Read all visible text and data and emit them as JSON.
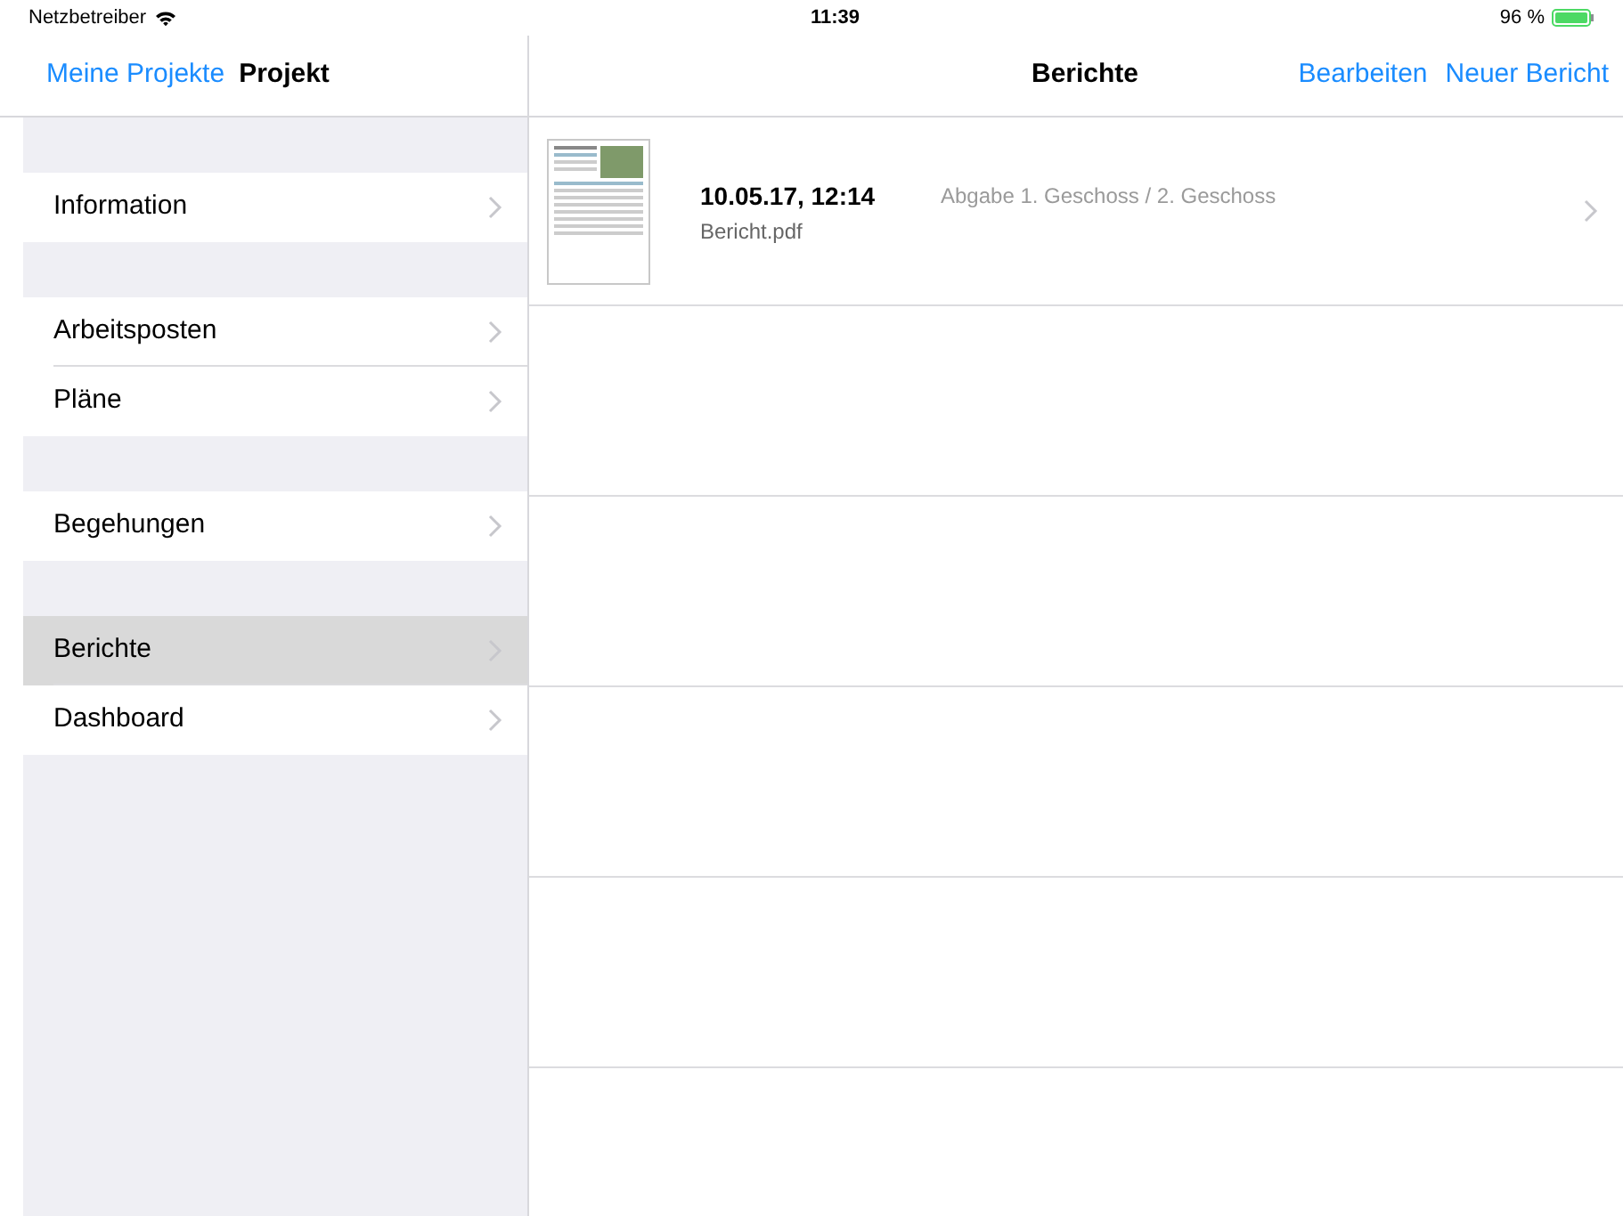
{
  "status_bar": {
    "carrier": "Netzbetreiber",
    "time": "11:39",
    "battery": "96 %"
  },
  "sidebar": {
    "back": "Meine Projekte",
    "title": "Projekt",
    "sections": [
      {
        "items": [
          {
            "label": "Information",
            "selected": false
          }
        ]
      },
      {
        "items": [
          {
            "label": "Arbeitsposten",
            "selected": false
          },
          {
            "label": "Pläne",
            "selected": false
          }
        ]
      },
      {
        "items": [
          {
            "label": "Begehungen",
            "selected": false
          }
        ]
      },
      {
        "items": [
          {
            "label": "Berichte",
            "selected": true
          },
          {
            "label": "Dashboard",
            "selected": false
          }
        ]
      }
    ]
  },
  "detail": {
    "title": "Berichte",
    "actions": [
      "Bearbeiten",
      "Neuer Bericht"
    ],
    "reports": [
      {
        "date": "10.05.17, 12:14",
        "file": "Bericht.pdf",
        "description": "Abgabe 1. Geschoss / 2. Geschoss"
      }
    ]
  }
}
